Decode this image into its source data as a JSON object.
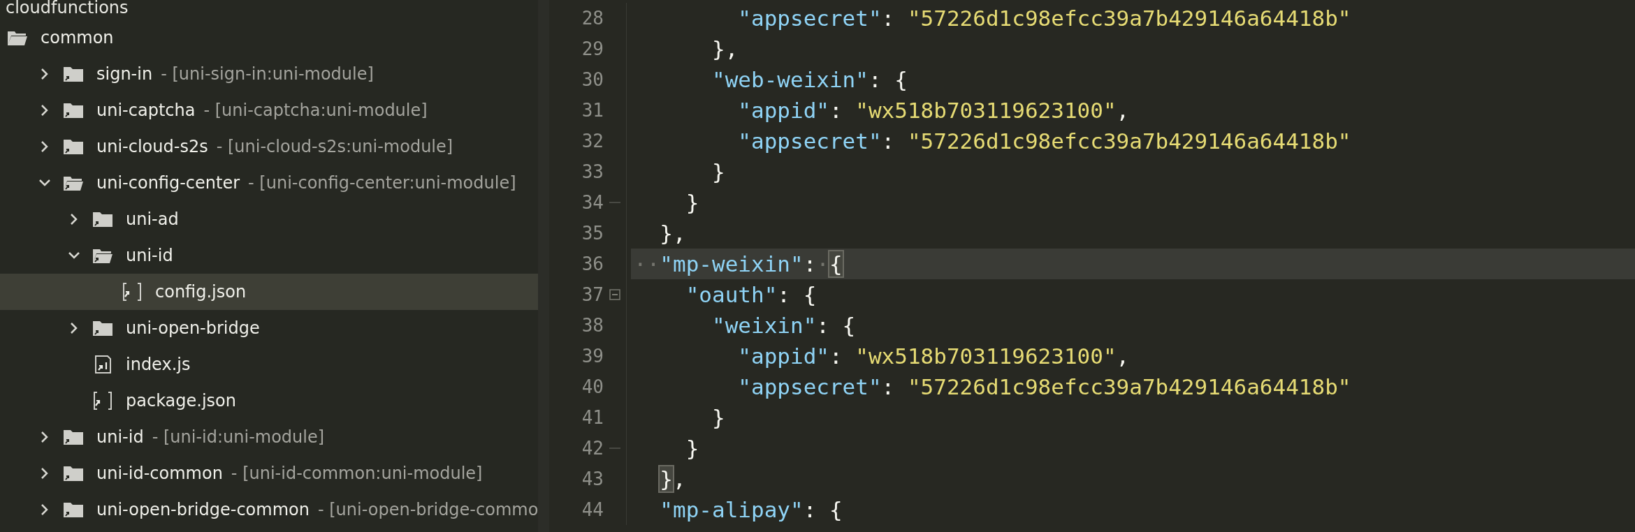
{
  "sidebar": {
    "title": "cloudfunctions",
    "tree": [
      {
        "kind": "root-folder",
        "label": "common",
        "expanded": true,
        "selected": false,
        "children": [
          {
            "kind": "folder",
            "label": "sign-in",
            "tag": "- [uni-sign-in:uni-module]",
            "expanded": false,
            "selected": false
          },
          {
            "kind": "folder",
            "label": "uni-captcha",
            "tag": "- [uni-captcha:uni-module]",
            "expanded": false,
            "selected": false
          },
          {
            "kind": "folder",
            "label": "uni-cloud-s2s",
            "tag": "- [uni-cloud-s2s:uni-module]",
            "expanded": false,
            "selected": false
          },
          {
            "kind": "folder",
            "label": "uni-config-center",
            "tag": "- [uni-config-center:uni-module]",
            "expanded": true,
            "selected": false,
            "children": [
              {
                "kind": "folder",
                "label": "uni-ad",
                "expanded": false,
                "selected": false
              },
              {
                "kind": "folder",
                "label": "uni-id",
                "expanded": true,
                "selected": false,
                "children": [
                  {
                    "kind": "json-file",
                    "label": "config.json",
                    "selected": true
                  }
                ]
              },
              {
                "kind": "folder",
                "label": "uni-open-bridge",
                "expanded": false,
                "selected": false
              },
              {
                "kind": "js-file",
                "label": "index.js",
                "selected": false
              },
              {
                "kind": "json-file",
                "label": "package.json",
                "selected": false
              }
            ]
          },
          {
            "kind": "folder",
            "label": "uni-id",
            "tag": "- [uni-id:uni-module]",
            "expanded": false,
            "selected": false
          },
          {
            "kind": "folder",
            "label": "uni-id-common",
            "tag": "- [uni-id-common:uni-module]",
            "expanded": false,
            "selected": false
          },
          {
            "kind": "folder",
            "label": "uni-open-bridge-common",
            "tag": "- [uni-open-bridge-commo",
            "expanded": false,
            "selected": false
          }
        ]
      }
    ]
  },
  "editor": {
    "lines": [
      {
        "number": "28",
        "selected": false,
        "tokens": [
          {
            "kind": "key",
            "text": "        \"appsecret\""
          },
          {
            "kind": "punct",
            "text": ": "
          },
          {
            "kind": "string",
            "text": "\"57226d1c98efcc39a7b429146a64418b\""
          }
        ]
      },
      {
        "number": "29",
        "selected": false,
        "tokens": [
          {
            "kind": "punct",
            "text": "      },"
          }
        ]
      },
      {
        "number": "30",
        "selected": false,
        "tokens": [
          {
            "kind": "key",
            "text": "      \"web-weixin\""
          },
          {
            "kind": "punct",
            "text": ": {"
          }
        ]
      },
      {
        "number": "31",
        "selected": false,
        "tokens": [
          {
            "kind": "key",
            "text": "        \"appid\""
          },
          {
            "kind": "punct",
            "text": ": "
          },
          {
            "kind": "string",
            "text": "\"wx518b703119623100\""
          },
          {
            "kind": "punct",
            "text": ","
          }
        ]
      },
      {
        "number": "32",
        "selected": false,
        "tokens": [
          {
            "kind": "key",
            "text": "        \"appsecret\""
          },
          {
            "kind": "punct",
            "text": ": "
          },
          {
            "kind": "string",
            "text": "\"57226d1c98efcc39a7b429146a64418b\""
          }
        ]
      },
      {
        "number": "33",
        "selected": false,
        "tokens": [
          {
            "kind": "punct",
            "text": "      }"
          }
        ]
      },
      {
        "number": "34",
        "selected": false,
        "kind": "fold-end",
        "tokens": [
          {
            "kind": "punct",
            "text": "    }"
          }
        ]
      },
      {
        "number": "35",
        "selected": false,
        "tokens": [
          {
            "kind": "punct",
            "text": "  },"
          }
        ]
      },
      {
        "number": "36",
        "selected": true,
        "tokens": [
          {
            "kind": "whitespace",
            "text": "··"
          },
          {
            "kind": "key",
            "text": "\"mp-weixin\""
          },
          {
            "kind": "punct",
            "text": ":"
          },
          {
            "kind": "whitespace",
            "text": "·"
          },
          {
            "kind": "bracket-match",
            "text": "{"
          }
        ]
      },
      {
        "number": "37",
        "selected": false,
        "kind": "fold-start",
        "tokens": [
          {
            "kind": "key",
            "text": "    \"oauth\""
          },
          {
            "kind": "punct",
            "text": ": {"
          }
        ]
      },
      {
        "number": "38",
        "selected": false,
        "tokens": [
          {
            "kind": "key",
            "text": "      \"weixin\""
          },
          {
            "kind": "punct",
            "text": ": {"
          }
        ]
      },
      {
        "number": "39",
        "selected": false,
        "tokens": [
          {
            "kind": "key",
            "text": "        \"appid\""
          },
          {
            "kind": "punct",
            "text": ": "
          },
          {
            "kind": "string",
            "text": "\"wx518b703119623100\""
          },
          {
            "kind": "punct",
            "text": ","
          }
        ]
      },
      {
        "number": "40",
        "selected": false,
        "tokens": [
          {
            "kind": "key",
            "text": "        \"appsecret\""
          },
          {
            "kind": "punct",
            "text": ": "
          },
          {
            "kind": "string",
            "text": "\"57226d1c98efcc39a7b429146a64418b\""
          }
        ]
      },
      {
        "number": "41",
        "selected": false,
        "tokens": [
          {
            "kind": "punct",
            "text": "      }"
          }
        ]
      },
      {
        "number": "42",
        "selected": false,
        "kind": "fold-end",
        "tokens": [
          {
            "kind": "punct",
            "text": "    }"
          }
        ]
      },
      {
        "number": "43",
        "selected": false,
        "tokens": [
          {
            "kind": "bracket-match",
            "text": "  }"
          },
          {
            "kind": "punct",
            "text": ","
          }
        ]
      },
      {
        "number": "44",
        "selected": false,
        "tokens": [
          {
            "kind": "key",
            "text": "  \"mp-alipay\""
          },
          {
            "kind": "punct",
            "text": ": {"
          }
        ]
      }
    ]
  }
}
